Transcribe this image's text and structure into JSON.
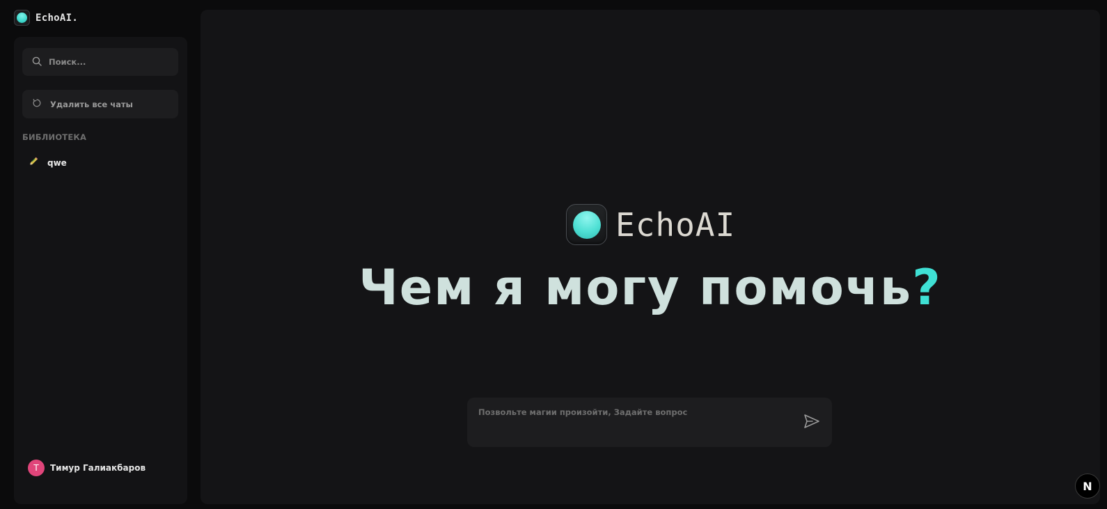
{
  "brand": {
    "name": "EchoAI."
  },
  "sidebar": {
    "search_placeholder": "Поиск...",
    "clear_all_label": "Удалить все чаты",
    "section_title": "БИБЛИОТЕКА",
    "items": [
      {
        "label": "qwe",
        "icon": "pencil-icon"
      }
    ],
    "user": {
      "initial": "T",
      "name": "Тимур Галиакбаров",
      "avatar_color": "#e0457a"
    }
  },
  "main": {
    "hero_name": "EchoAI",
    "headline": "Чем я могу помочь",
    "headline_mark": "?",
    "accent_color": "#3fe0d4",
    "composer_placeholder": "Позвольте магии произойти, Задайте вопрос"
  },
  "badge": {
    "label": "N"
  }
}
